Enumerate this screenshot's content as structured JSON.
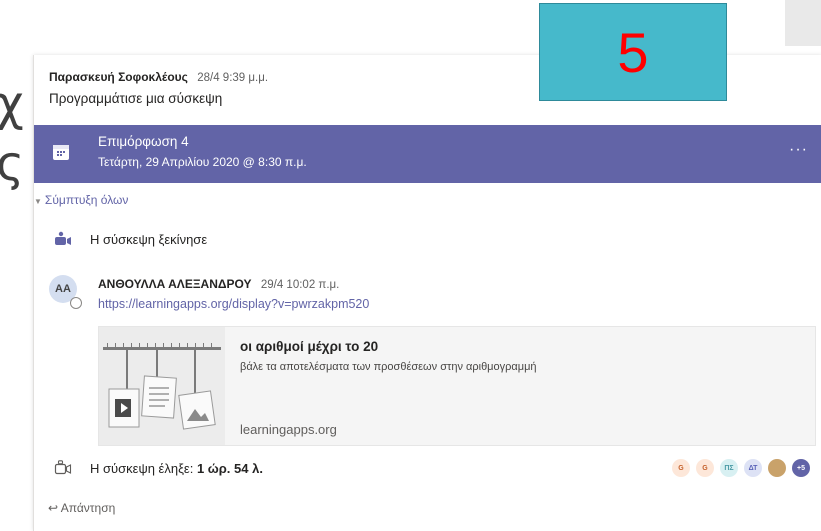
{
  "background_glyphs": [
    "χ",
    "ς"
  ],
  "post": {
    "author": "Παρασκευή Σοφοκλέους",
    "time": "28/4 9:39 μ.μ.",
    "text": "Προγραμμάτισε μια σύσκεψη"
  },
  "meeting": {
    "title": "Επιμόρφωση 4",
    "date": "Τετάρτη, 29 Απριλίου 2020 @ 8:30 π.μ.",
    "more_label": "···",
    "bar_color": "#6264a7"
  },
  "collapse_label": "Σύμπτυξη όλων",
  "meeting_started": "Η σύσκεψη ξεκίνησε",
  "reply_post": {
    "avatar_initials": "AA",
    "author": "ΑΝΘΟΥΛΛΑ ΑΛΕΞΑΝΔΡΟΥ",
    "time": "29/4 10:02 π.μ.",
    "link": "https://learningapps.org/display?v=pwrzakpm520"
  },
  "link_preview": {
    "title": "οι αριθμοί μέχρι το 20",
    "description": "βάλε τα αποτελέσματα των προσθέσεων στην αριθμογραμμή",
    "domain": "learningapps.org"
  },
  "meeting_ended": {
    "prefix": "Η σύσκεψη έληξε: ",
    "duration": "1 ώρ. 54 λ."
  },
  "participants": [
    {
      "initials": "G",
      "bg": "#fde7d9",
      "fg": "#c4602a"
    },
    {
      "initials": "G",
      "bg": "#fde7d9",
      "fg": "#c4602a"
    },
    {
      "initials": "ΠΣ",
      "bg": "#d8f0f2",
      "fg": "#4a9aa5"
    },
    {
      "initials": "ΔΤ",
      "bg": "#dde2f5",
      "fg": "#5a63b8"
    },
    {
      "initials": "",
      "bg": "#c9a26a",
      "fg": "#ffffff"
    },
    {
      "initials": "+5",
      "bg": "#6264a7",
      "fg": "#ffffff"
    }
  ],
  "reply_label": "Απάντηση",
  "overlay_number": "5"
}
